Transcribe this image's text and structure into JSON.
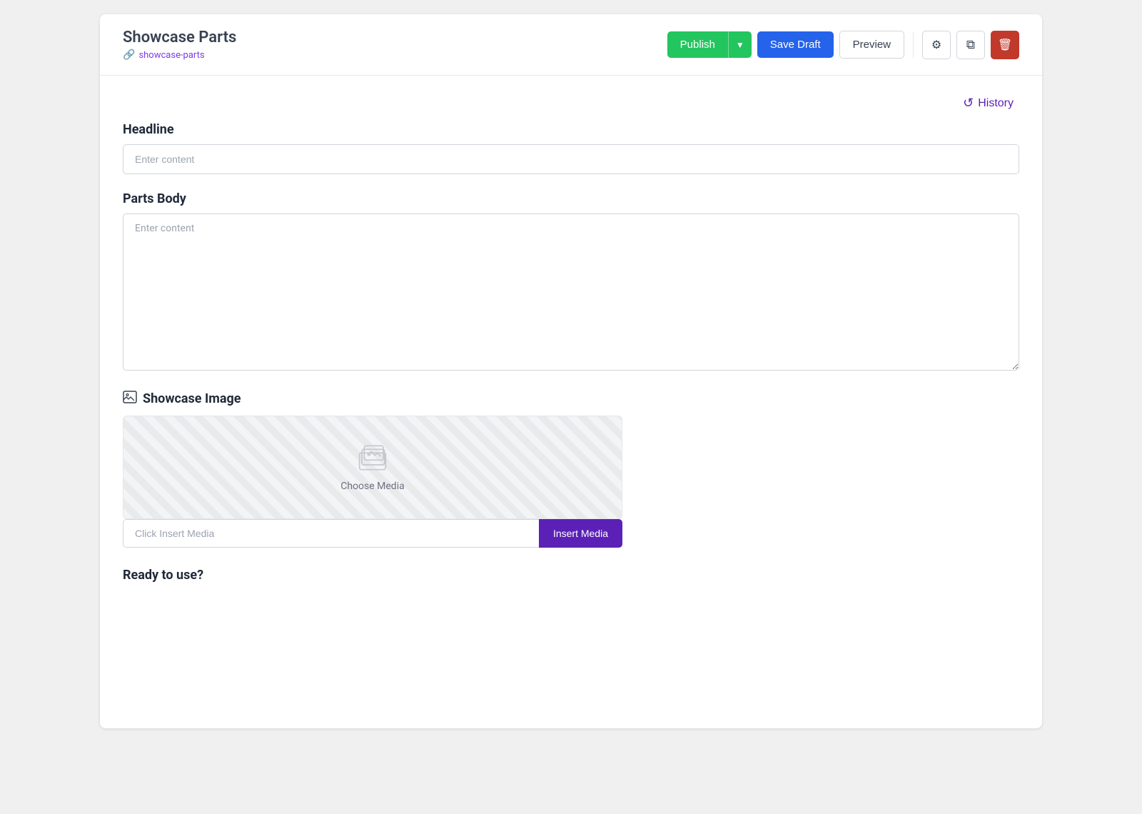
{
  "header": {
    "title": "Showcase Parts",
    "slug": "showcase-parts",
    "slug_icon": "🔗",
    "publish_label": "Publish",
    "publish_arrow": "▼",
    "save_draft_label": "Save Draft",
    "preview_label": "Preview",
    "settings_icon": "⚙",
    "duplicate_icon": "⧉",
    "delete_icon": "🗑"
  },
  "history": {
    "label": "History",
    "icon": "↺"
  },
  "form": {
    "headline": {
      "label": "Headline",
      "placeholder": "Enter content"
    },
    "parts_body": {
      "label": "Parts Body",
      "placeholder": "Enter content"
    },
    "showcase_image": {
      "label": "Showcase Image",
      "choose_media_label": "Choose Media",
      "insert_input_placeholder": "Click Insert Media",
      "insert_button_label": "Insert Media"
    },
    "ready_to_use": {
      "label": "Ready to use?"
    }
  }
}
